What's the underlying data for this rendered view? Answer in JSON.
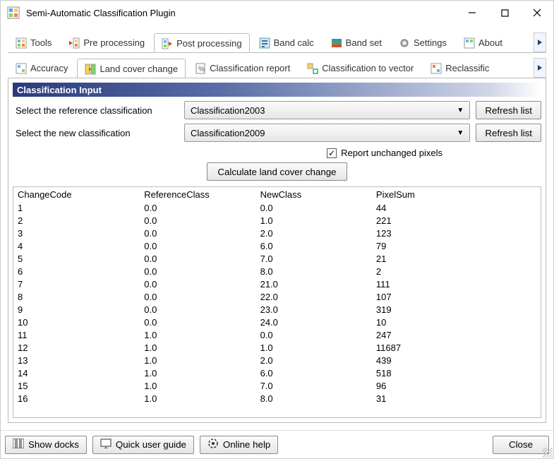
{
  "window": {
    "title": "Semi-Automatic Classification Plugin"
  },
  "tabs_main": {
    "tools": "Tools",
    "pre": "Pre processing",
    "post": "Post processing",
    "bandcalc": "Band calc",
    "bandset": "Band set",
    "settings": "Settings",
    "about": "About"
  },
  "tabs_sub": {
    "accuracy": "Accuracy",
    "lcc": "Land cover change",
    "report": "Classification report",
    "tovector": "Classification to vector",
    "reclass": "Reclassific"
  },
  "section": {
    "title": "Classification Input"
  },
  "form": {
    "ref_label": "Select the reference classification",
    "ref_value": "Classification2003",
    "new_label": "Select the new classification",
    "new_value": "Classification2009",
    "refresh_label": "Refresh list",
    "report_unchanged_label": "Report unchanged pixels",
    "report_unchanged_checked": true,
    "calc_label": "Calculate land cover change"
  },
  "table": {
    "headers": {
      "c0": "ChangeCode",
      "c1": "ReferenceClass",
      "c2": "NewClass",
      "c3": "PixelSum"
    },
    "rows": [
      {
        "c0": "1",
        "c1": "0.0",
        "c2": "0.0",
        "c3": "44"
      },
      {
        "c0": "2",
        "c1": "0.0",
        "c2": "1.0",
        "c3": "221"
      },
      {
        "c0": "3",
        "c1": "0.0",
        "c2": "2.0",
        "c3": "123"
      },
      {
        "c0": "4",
        "c1": "0.0",
        "c2": "6.0",
        "c3": "79"
      },
      {
        "c0": "5",
        "c1": "0.0",
        "c2": "7.0",
        "c3": "21"
      },
      {
        "c0": "6",
        "c1": "0.0",
        "c2": "8.0",
        "c3": "2"
      },
      {
        "c0": "7",
        "c1": "0.0",
        "c2": "21.0",
        "c3": "111"
      },
      {
        "c0": "8",
        "c1": "0.0",
        "c2": "22.0",
        "c3": "107"
      },
      {
        "c0": "9",
        "c1": "0.0",
        "c2": "23.0",
        "c3": "319"
      },
      {
        "c0": "10",
        "c1": "0.0",
        "c2": "24.0",
        "c3": "10"
      },
      {
        "c0": "11",
        "c1": "1.0",
        "c2": "0.0",
        "c3": "247"
      },
      {
        "c0": "12",
        "c1": "1.0",
        "c2": "1.0",
        "c3": "11687"
      },
      {
        "c0": "13",
        "c1": "1.0",
        "c2": "2.0",
        "c3": "439"
      },
      {
        "c0": "14",
        "c1": "1.0",
        "c2": "6.0",
        "c3": "518"
      },
      {
        "c0": "15",
        "c1": "1.0",
        "c2": "7.0",
        "c3": "96"
      },
      {
        "c0": "16",
        "c1": "1.0",
        "c2": "8.0",
        "c3": "31"
      }
    ]
  },
  "footer": {
    "show_docks": "Show docks",
    "quick_guide": "Quick user guide",
    "online_help": "Online help",
    "close": "Close"
  }
}
